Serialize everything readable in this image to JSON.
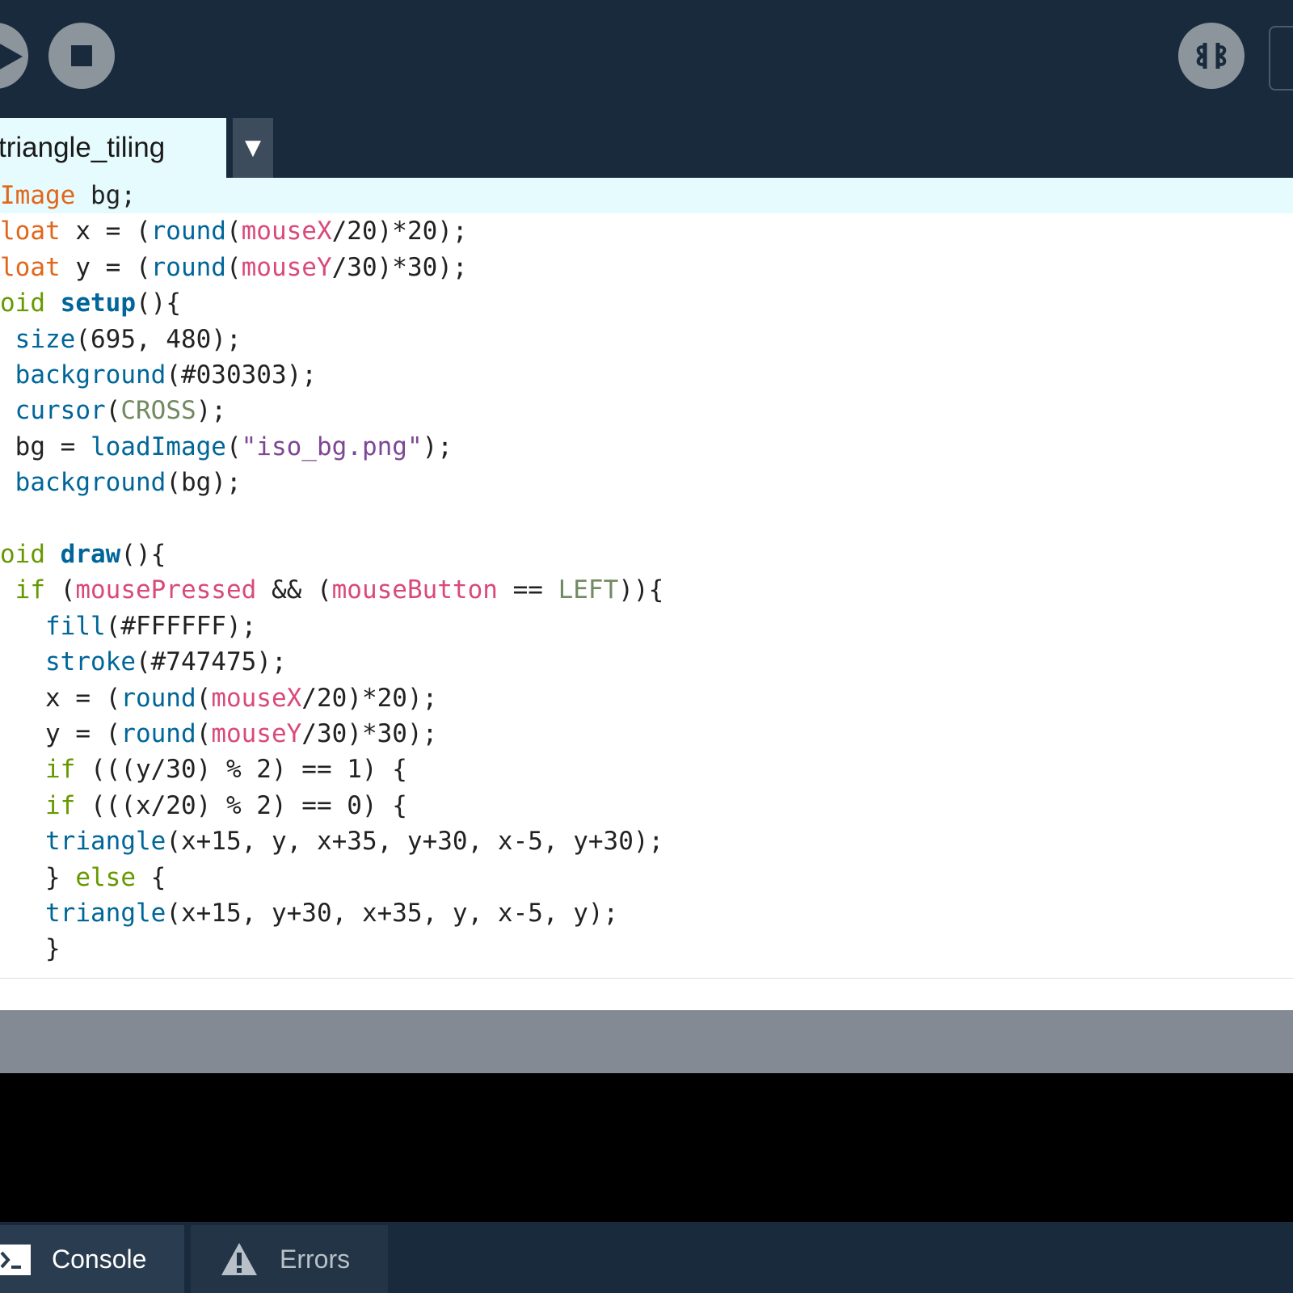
{
  "toolbar": {
    "run_icon": "play-icon",
    "stop_icon": "stop-icon",
    "debug_icon": "debugger-butterfly-icon"
  },
  "tab": {
    "label": "triangle_tiling",
    "menu_glyph": "▼"
  },
  "editor": {
    "lines": [
      [
        [
          "Image",
          "kw-type"
        ],
        [
          " bg;",
          ""
        ]
      ],
      [
        [
          "loat",
          "kw-type"
        ],
        [
          " x = (",
          ""
        ],
        [
          "round",
          "fn"
        ],
        [
          "(",
          ""
        ],
        [
          "mouseX",
          "var"
        ],
        [
          "/20)*20);",
          ""
        ]
      ],
      [
        [
          "loat",
          "kw-type"
        ],
        [
          " y = (",
          ""
        ],
        [
          "round",
          "fn"
        ],
        [
          "(",
          ""
        ],
        [
          "mouseY",
          "var"
        ],
        [
          "/30)*30);",
          ""
        ]
      ],
      [
        [
          "oid",
          "kw-ctl"
        ],
        [
          " ",
          ""
        ],
        [
          "setup",
          "fn-def"
        ],
        [
          "(){",
          ""
        ]
      ],
      [
        [
          " ",
          ""
        ],
        [
          "size",
          "fn"
        ],
        [
          "(695, 480);",
          ""
        ]
      ],
      [
        [
          " ",
          ""
        ],
        [
          "background",
          "fn"
        ],
        [
          "(#030303);",
          ""
        ]
      ],
      [
        [
          " ",
          ""
        ],
        [
          "cursor",
          "fn"
        ],
        [
          "(",
          ""
        ],
        [
          "CROSS",
          "const"
        ],
        [
          ");",
          ""
        ]
      ],
      [
        [
          " bg = ",
          ""
        ],
        [
          "loadImage",
          "fn"
        ],
        [
          "(",
          ""
        ],
        [
          "\"iso_bg.png\"",
          "str"
        ],
        [
          ");",
          ""
        ]
      ],
      [
        [
          " ",
          ""
        ],
        [
          "background",
          "fn"
        ],
        [
          "(bg);",
          ""
        ]
      ],
      [],
      [
        [
          "oid",
          "kw-ctl"
        ],
        [
          " ",
          ""
        ],
        [
          "draw",
          "fn-def"
        ],
        [
          "(){",
          ""
        ]
      ],
      [
        [
          " ",
          ""
        ],
        [
          "if",
          "kw-ctl"
        ],
        [
          " (",
          ""
        ],
        [
          "mousePressed",
          "var"
        ],
        [
          " && (",
          ""
        ],
        [
          "mouseButton",
          "var"
        ],
        [
          " == ",
          ""
        ],
        [
          "LEFT",
          "const"
        ],
        [
          ")){",
          ""
        ]
      ],
      [
        [
          "   ",
          ""
        ],
        [
          "fill",
          "fn"
        ],
        [
          "(#FFFFFF);",
          ""
        ]
      ],
      [
        [
          "   ",
          ""
        ],
        [
          "stroke",
          "fn"
        ],
        [
          "(#747475);",
          ""
        ]
      ],
      [
        [
          "   x = (",
          ""
        ],
        [
          "round",
          "fn"
        ],
        [
          "(",
          ""
        ],
        [
          "mouseX",
          "var"
        ],
        [
          "/20)*20);",
          ""
        ]
      ],
      [
        [
          "   y = (",
          ""
        ],
        [
          "round",
          "fn"
        ],
        [
          "(",
          ""
        ],
        [
          "mouseY",
          "var"
        ],
        [
          "/30)*30);",
          ""
        ]
      ],
      [
        [
          "   ",
          ""
        ],
        [
          "if",
          "kw-ctl"
        ],
        [
          " (((y/30) % 2) == 1) {",
          ""
        ]
      ],
      [
        [
          "   ",
          ""
        ],
        [
          "if",
          "kw-ctl"
        ],
        [
          " (((x/20) % 2) == 0) {",
          ""
        ]
      ],
      [
        [
          "   ",
          ""
        ],
        [
          "triangle",
          "fn"
        ],
        [
          "(x+15, y, x+35, y+30, x-5, y+30);",
          ""
        ]
      ],
      [
        [
          "   } ",
          ""
        ],
        [
          "else",
          "kw-ctl"
        ],
        [
          " {",
          ""
        ]
      ],
      [
        [
          "   ",
          ""
        ],
        [
          "triangle",
          "fn"
        ],
        [
          "(x+15, y+30, x+35, y, x-5, y);",
          ""
        ]
      ],
      [
        [
          "   }",
          ""
        ]
      ]
    ]
  },
  "footer": {
    "console_label": "Console",
    "console_icon": "terminal-icon",
    "errors_label": "Errors",
    "errors_icon": "warning-icon"
  }
}
